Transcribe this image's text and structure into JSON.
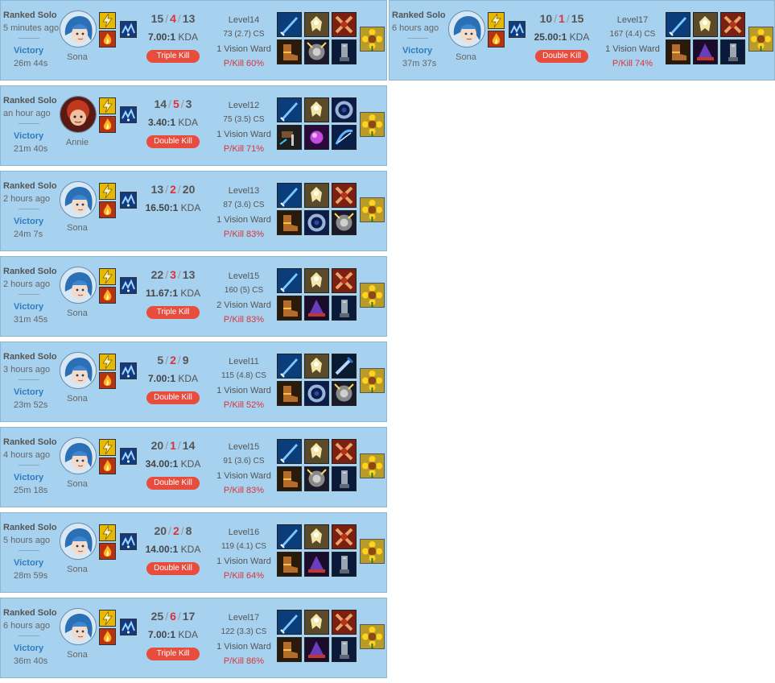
{
  "cards_left": [
    {
      "type": "Ranked Solo",
      "ago": "5 minutes ago",
      "result": "Victory",
      "duration": "26m 44s",
      "champion": "Sona",
      "champ_icon": "sona-portrait",
      "k": "15",
      "d": "4",
      "a": "13",
      "kda": "7.00:1",
      "multi": "Triple Kill",
      "level": "Level14",
      "cs": "73 (2.7) CS",
      "ward": "1 Vision Ward",
      "pkill": "P/Kill 60%",
      "items": [
        "sword-icon",
        "wing-icon",
        "cross-icon",
        "boots-icon",
        "shield-icon",
        "tower-icon"
      ]
    },
    {
      "type": "Ranked Solo",
      "ago": "an hour ago",
      "result": "Victory",
      "duration": "21m 40s",
      "champion": "Annie",
      "champ_icon": "annie-portrait",
      "k": "14",
      "d": "5",
      "a": "3",
      "kda": "3.40:1",
      "multi": "Double Kill",
      "level": "Level12",
      "cs": "75 (3.5) CS",
      "ward": "1 Vision Ward",
      "pkill": "P/Kill 71%",
      "items": [
        "sword-icon",
        "wing-icon",
        "ring-icon",
        "hammer-icon",
        "orb-icon",
        "bow-icon"
      ]
    },
    {
      "type": "Ranked Solo",
      "ago": "2 hours ago",
      "result": "Victory",
      "duration": "24m 7s",
      "champion": "Sona",
      "champ_icon": "sona-portrait",
      "k": "13",
      "d": "2",
      "a": "20",
      "kda": "16.50:1",
      "multi": "",
      "level": "Level13",
      "cs": "87 (3.6) CS",
      "ward": "1 Vision Ward",
      "pkill": "P/Kill 83%",
      "items": [
        "sword-icon",
        "wing-icon",
        "cross-icon",
        "boots-icon",
        "ring-icon",
        "shield-icon"
      ]
    },
    {
      "type": "Ranked Solo",
      "ago": "2 hours ago",
      "result": "Victory",
      "duration": "31m 45s",
      "champion": "Sona",
      "champ_icon": "sona-portrait",
      "k": "22",
      "d": "3",
      "a": "13",
      "kda": "11.67:1",
      "multi": "Triple Kill",
      "level": "Level15",
      "cs": "160 (5) CS",
      "ward": "2 Vision Ward",
      "pkill": "P/Kill 83%",
      "items": [
        "sword-icon",
        "wing-icon",
        "cross-icon",
        "boots-icon",
        "hat-icon",
        "tower-icon"
      ]
    },
    {
      "type": "Ranked Solo",
      "ago": "3 hours ago",
      "result": "Victory",
      "duration": "23m 52s",
      "champion": "Sona",
      "champ_icon": "sona-portrait",
      "k": "5",
      "d": "2",
      "a": "9",
      "kda": "7.00:1",
      "multi": "Double Kill",
      "level": "Level11",
      "cs": "115 (4.8) CS",
      "ward": "1 Vision Ward",
      "pkill": "P/Kill 52%",
      "items": [
        "sword-icon",
        "wing-icon",
        "blade-icon",
        "boots-icon",
        "ring-icon",
        "shield-icon"
      ]
    },
    {
      "type": "Ranked Solo",
      "ago": "4 hours ago",
      "result": "Victory",
      "duration": "25m 18s",
      "champion": "Sona",
      "champ_icon": "sona-portrait",
      "k": "20",
      "d": "1",
      "a": "14",
      "kda": "34.00:1",
      "multi": "Double Kill",
      "level": "Level15",
      "cs": "91 (3.6) CS",
      "ward": "1 Vision Ward",
      "pkill": "P/Kill 83%",
      "items": [
        "sword-icon",
        "wing-icon",
        "cross-icon",
        "boots-icon",
        "shield-icon",
        "tower-icon"
      ]
    },
    {
      "type": "Ranked Solo",
      "ago": "5 hours ago",
      "result": "Victory",
      "duration": "28m 59s",
      "champion": "Sona",
      "champ_icon": "sona-portrait",
      "k": "20",
      "d": "2",
      "a": "8",
      "kda": "14.00:1",
      "multi": "Double Kill",
      "level": "Level16",
      "cs": "119 (4.1) CS",
      "ward": "1 Vision Ward",
      "pkill": "P/Kill 64%",
      "items": [
        "sword-icon",
        "wing-icon",
        "cross-icon",
        "boots-icon",
        "hat-icon",
        "tower-icon"
      ]
    },
    {
      "type": "Ranked Solo",
      "ago": "6 hours ago",
      "result": "Victory",
      "duration": "36m 40s",
      "champion": "Sona",
      "champ_icon": "sona-portrait",
      "k": "25",
      "d": "6",
      "a": "17",
      "kda": "7.00:1",
      "multi": "Triple Kill",
      "level": "Level17",
      "cs": "122 (3.3) CS",
      "ward": "1 Vision Ward",
      "pkill": "P/Kill 86%",
      "items": [
        "sword-icon",
        "wing-icon",
        "cross-icon",
        "boots-icon",
        "hat-icon",
        "tower-icon"
      ]
    }
  ],
  "cards_right": [
    {
      "type": "Ranked Solo",
      "ago": "6 hours ago",
      "result": "Victory",
      "duration": "37m 37s",
      "champion": "Sona",
      "champ_icon": "sona-portrait",
      "k": "10",
      "d": "1",
      "a": "15",
      "kda": "25.00:1",
      "multi": "Double Kill",
      "level": "Level17",
      "cs": "167 (4.4) CS",
      "ward": "1 Vision Ward",
      "pkill": "P/Kill 74%",
      "items": [
        "sword-icon",
        "wing-icon",
        "cross-icon",
        "boots-icon",
        "hat-icon",
        "tower-icon"
      ]
    }
  ],
  "spell_icons": {
    "spell1": "flash-spell-icon",
    "spell2": "ignite-spell-icon",
    "rune": "keystone-rune-icon",
    "trinket": "sunflower-trinket-icon"
  },
  "kda_label": "KDA",
  "colors": {
    "card_bg": "#a6d1ef",
    "victory": "#2f7cc0",
    "deaths": "#d9343a",
    "badge": "#e74c3c"
  }
}
